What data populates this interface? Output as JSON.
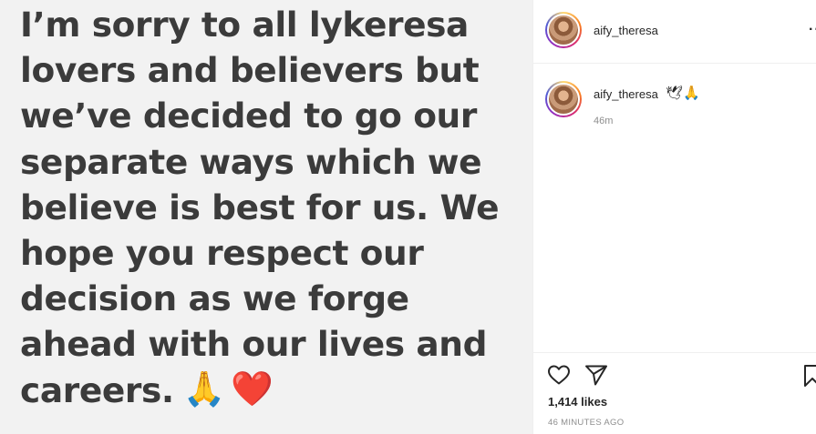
{
  "post": {
    "text": "I’m sorry to all lykeresa\nlovers and believers but\nwe’ve decided to go our\nseparate ways which we\nbelieve is best for us. We\nhope you respect our\ndecision as we forge\nahead with our lives and\ncareers.",
    "emojis": [
      "🙏",
      "❤️"
    ]
  },
  "header": {
    "username": "aify_theresa",
    "more_icon": "more-options-icon"
  },
  "caption": {
    "username": "aify_theresa",
    "emojis": "🕊🙏",
    "time": "46m"
  },
  "actions": {
    "like_icon": "heart-icon",
    "share_icon": "paper-plane-icon",
    "save_icon": "bookmark-icon",
    "likes": "1,414 likes",
    "time_ago": "46 MINUTES AGO"
  }
}
